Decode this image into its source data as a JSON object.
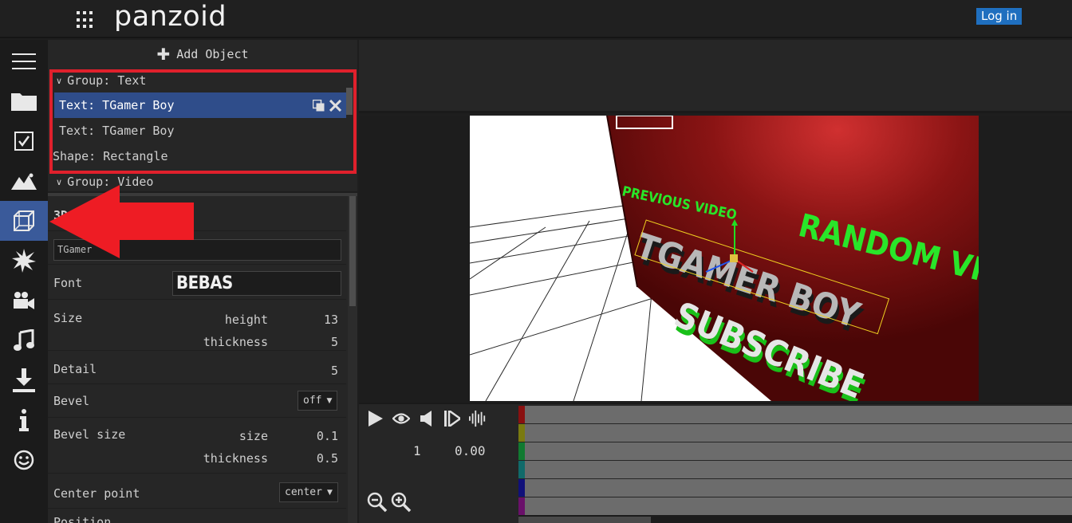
{
  "app": {
    "logo": "panzoid",
    "login_label": "Log in",
    "accent_color": "#1f6fbf",
    "selected_color": "#2f4d8a"
  },
  "rail": {
    "icons": [
      "menu-icon",
      "folder-icon",
      "checkbox-icon",
      "mountains-icon",
      "cube-wireframe-icon",
      "starburst-icon",
      "video-camera-icon",
      "music-note-icon",
      "download-icon",
      "info-icon",
      "smiley-icon"
    ],
    "active": "cube-wireframe-icon"
  },
  "objects": {
    "add_label": "Add Object",
    "group_text": "Group: Text",
    "item_selected": "Text: TGamer Boy",
    "item_2": "Text: TGamer Boy",
    "item_3": "Shape: Rectangle",
    "group_video": "Group: Video"
  },
  "properties": {
    "section_title": "3D",
    "text_value": "TGamer",
    "font_label": "Font",
    "font_value": "BEBAS",
    "size_label": "Size",
    "height_label": "height",
    "height_value": "13",
    "thickness_label": "thickness",
    "thickness_value": "5",
    "detail_label": "Detail",
    "detail_value": "5",
    "bevel_label": "Bevel",
    "bevel_value": "off",
    "bevel_size_label": "Bevel size",
    "bevel_size_sub": "size",
    "bevel_size_value": "0.1",
    "bevel_thickness_label": "thickness",
    "bevel_thickness_value": "0.5",
    "center_label": "Center point",
    "center_value": "center",
    "position_label": "Position"
  },
  "scene": {
    "text_previous": "PREVIOUS VIDEO",
    "text_random": "RANDOM VI",
    "text_main": "TGAMER BOY",
    "text_subscribe": "SUBSCRIBE"
  },
  "timeline": {
    "frame": "1",
    "time": "0.00",
    "track_colors": [
      "#8a1010",
      "#7a7a10",
      "#107a30",
      "#106a6a",
      "#10107a",
      "#6a106a"
    ]
  },
  "annotation": {
    "highlight_color": "#e0202c"
  }
}
